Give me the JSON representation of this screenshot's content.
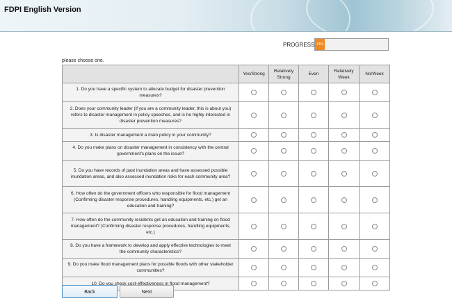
{
  "app": {
    "title": "FDPI English Version"
  },
  "progress": {
    "label": "PROGRESS",
    "percent": 13,
    "text": "13%"
  },
  "instruction": "please choose one.",
  "columns": [
    "Yes/Strong",
    "Relatively Strong",
    "Even",
    "Relatively Week",
    "No/Week"
  ],
  "questions": [
    "1. Do you have a specific system to allocate budget for disaster prevention measures?",
    "2. Does your community leader (if you are a community leader, this is about you) refers to disaster management in policy speeches, and is he highly interested in disaster prevention measures?",
    "3. Is disaster management a main policy in your community?",
    "4. Do you make plans on disaster management in consistency with the central government's plans on the issue?",
    "5. Do you have records of past inundation areas and have assessed possible inundation areas, and also assessed inundation risks for each community area?",
    "6. How often do the government officers who responsible for flood management (Confirming disaster response procedures, handling equipments, etc.) get an education and training?",
    "7. How often do the community residents get an education and training on flood management? (Confirming disaster response procedures, handling equipments, etc.)",
    "8. Do you have a framework to develop and apply effective technologies to meet the community characteristics?",
    "9. Do you make flood management plans for possible floods with other stakeholder communities?",
    "10. Do you check cost-effectiveness in flood management?"
  ],
  "buttons": {
    "back": "Back",
    "next": "Next"
  }
}
